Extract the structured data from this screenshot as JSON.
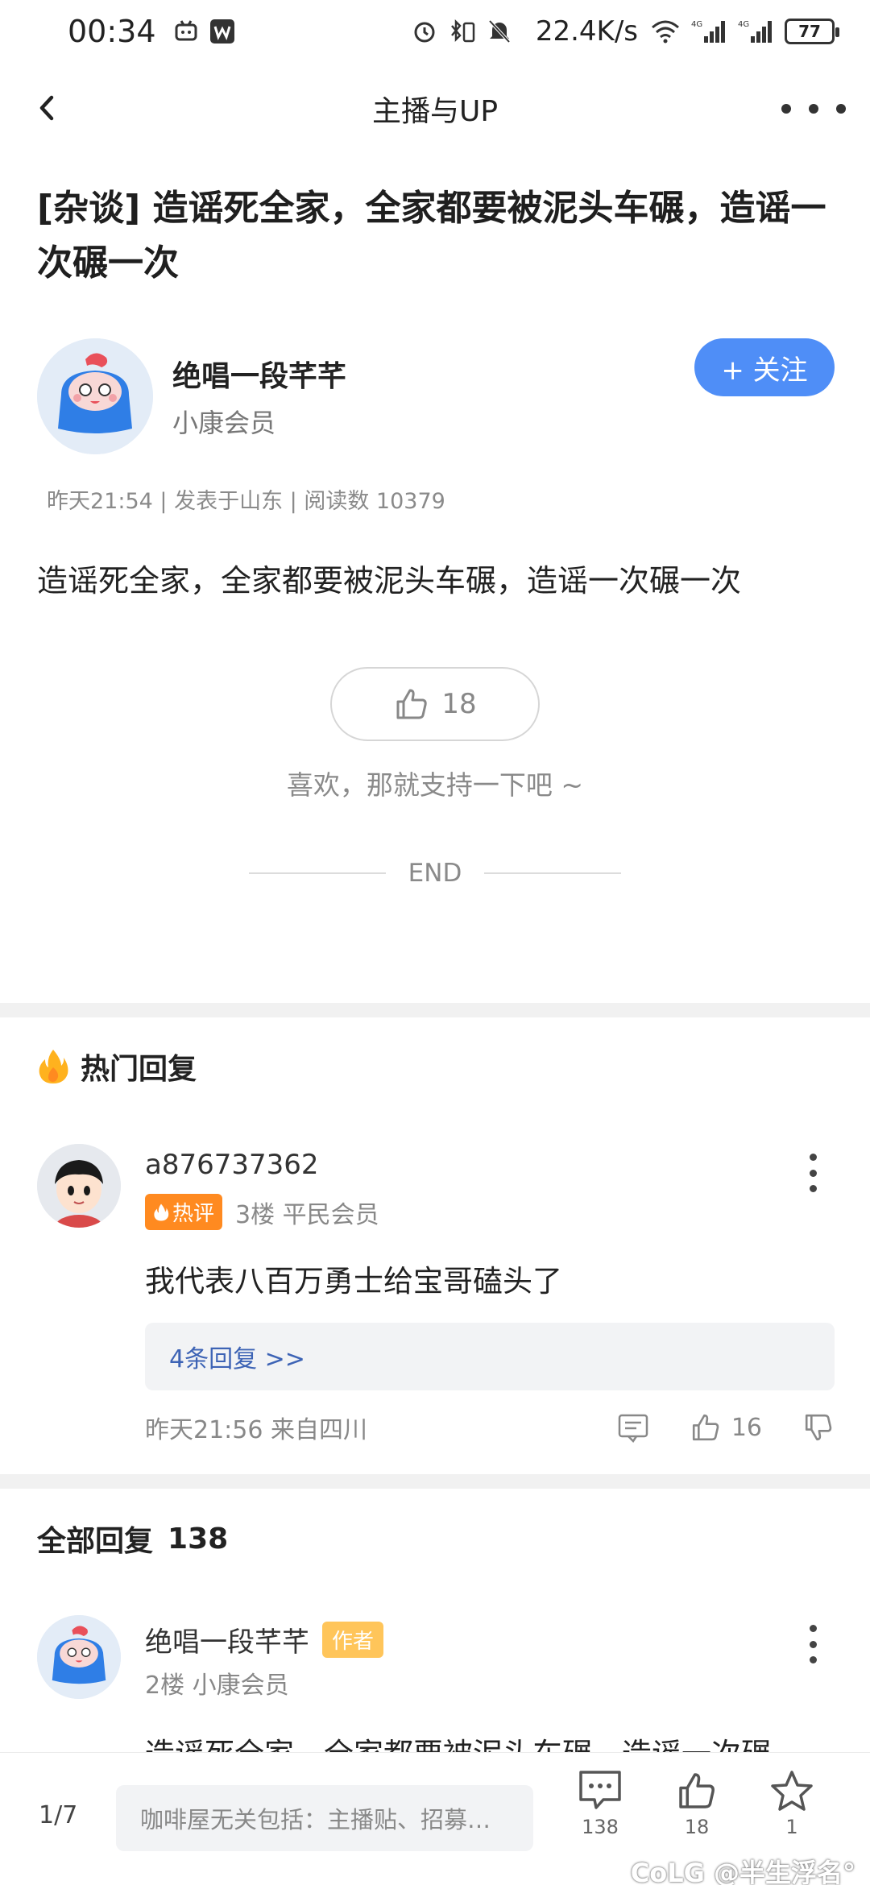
{
  "status_bar": {
    "time": "00:34",
    "net_speed": "22.4K/s",
    "signal1": "4G",
    "signal2": "4G",
    "battery": "77"
  },
  "header": {
    "title": "主播与UP"
  },
  "post": {
    "title": "[杂谈] 造谣死全家，全家都要被泥头车碾，造谣一次碾一次",
    "author_name": "绝唱一段芊芊",
    "author_level": "小康会员",
    "follow_label": "+ 关注",
    "meta": "昨天21:54 | 发表于山东 | 阅读数 10379",
    "body": "造谣死全家，全家都要被泥头车碾，造谣一次碾一次",
    "like_count": "18",
    "support_text": "喜欢，那就支持一下吧 ~",
    "end_label": "END"
  },
  "hot": {
    "section_title": "热门回复",
    "comment": {
      "name": "a876737362",
      "badge": "热评",
      "floor_level": "3楼 平民会员",
      "text": "我代表八百万勇士给宝哥磕头了",
      "replies": "4条回复 >>",
      "footer": "昨天21:56 来自四川",
      "likes": "16"
    }
  },
  "all": {
    "section_title": "全部回复",
    "count": "138",
    "comment": {
      "name": "绝唱一段芊芊",
      "badge": "作者",
      "floor_level": "2楼 小康会员",
      "text": "造谣死全家，全家都要被泥头车碾，造谣一次碾"
    }
  },
  "bottom_bar": {
    "page": "1/7",
    "input_placeholder": "咖啡屋无关包括：主播贴、招募…",
    "comments": "138",
    "likes": "18",
    "favorites": "1"
  },
  "watermark": "CoLG @半生浮名°",
  "colors": {
    "accent": "#4f8ef7",
    "hot_badge": "#ff8a20",
    "author_badge": "#ffc55a",
    "reply_link": "#3d63b5"
  }
}
